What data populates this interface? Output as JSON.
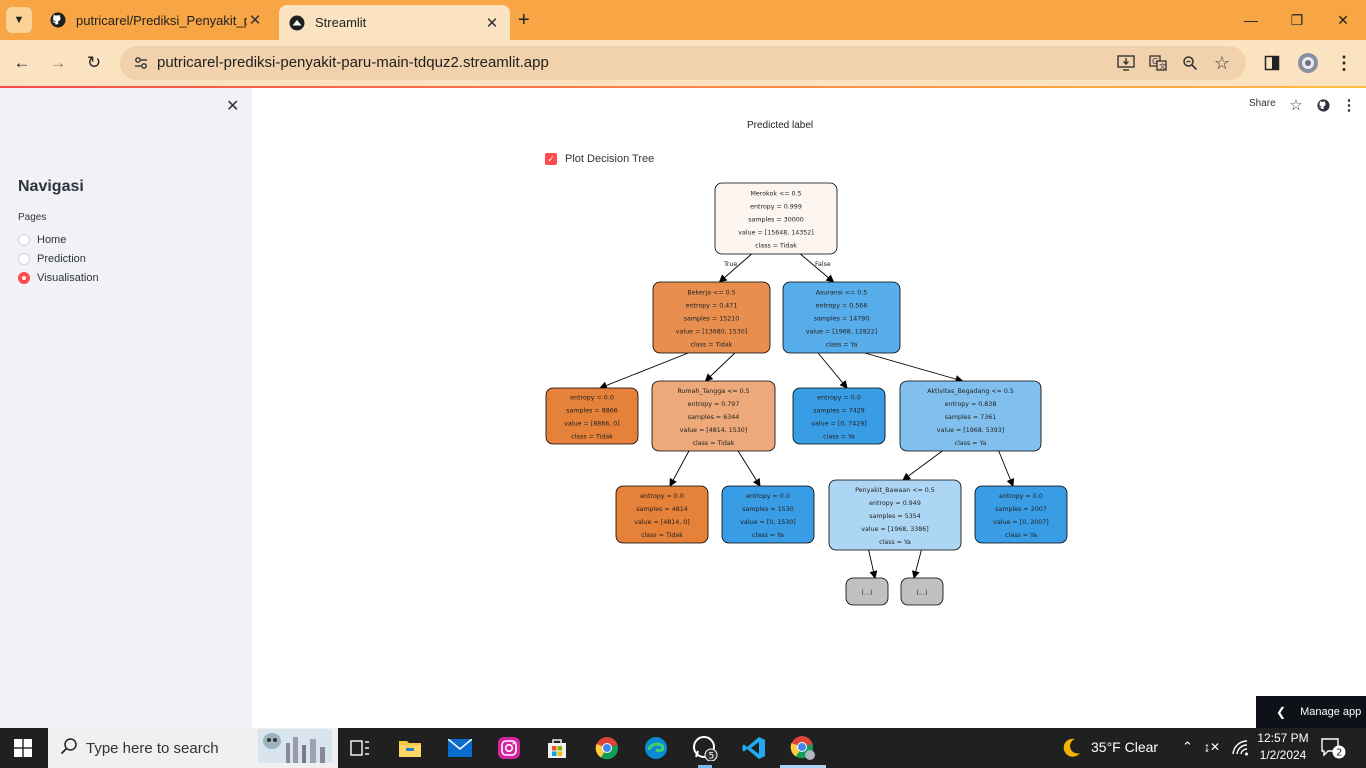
{
  "browser": {
    "tabs": [
      {
        "title": "putricarel/Prediksi_Penyakit_pa",
        "icon": "github-icon"
      },
      {
        "title": "Streamlit",
        "icon": "streamlit-icon"
      }
    ],
    "url": "putricarel-prediksi-penyakit-paru-main-tdquz2.streamlit.app",
    "accent_color": "#f7a545"
  },
  "sidebar": {
    "title": "Navigasi",
    "pages_label": "Pages",
    "items": [
      {
        "label": "Home",
        "selected": false
      },
      {
        "label": "Prediction",
        "selected": false
      },
      {
        "label": "Visualisation",
        "selected": true
      }
    ]
  },
  "header": {
    "share_label": "Share"
  },
  "main": {
    "predicted_label": "Predicted label",
    "checkbox_label": "Plot Decision Tree",
    "checkbox_checked": true
  },
  "tree": {
    "edge_true": "True",
    "edge_false": "False",
    "nodes": [
      {
        "id": "n0",
        "lines": [
          "Merokok <= 0.5",
          "entropy = 0.999",
          "samples = 30000",
          "value = [15648, 14352]",
          "class = Tidak"
        ],
        "fill": "#fdf5ef"
      },
      {
        "id": "n1",
        "lines": [
          "Bekerja <= 0.5",
          "entropy = 0.471",
          "samples = 15210",
          "value = [13680, 1530]",
          "class = Tidak"
        ],
        "fill": "#e88f4f"
      },
      {
        "id": "n2",
        "lines": [
          "Asuransi <= 0.5",
          "entropy = 0.566",
          "samples = 14790",
          "value = [1968, 12822]",
          "class = Ya"
        ],
        "fill": "#57acea"
      },
      {
        "id": "n3",
        "lines": [
          "entropy = 0.0",
          "samples = 8866",
          "value = [8866, 0]",
          "class = Tidak"
        ],
        "fill": "#e58139"
      },
      {
        "id": "n4",
        "lines": [
          "Rumah_Tangga <= 0.5",
          "entropy = 0.797",
          "samples = 6344",
          "value = [4814, 1530]",
          "class = Tidak"
        ],
        "fill": "#eda979"
      },
      {
        "id": "n5",
        "lines": [
          "entropy = 0.0",
          "samples = 7429",
          "value = [0, 7429]",
          "class = Ya"
        ],
        "fill": "#399de5"
      },
      {
        "id": "n6",
        "lines": [
          "Aktivitas_Begadang <= 0.5",
          "entropy = 0.838",
          "samples = 7361",
          "value = [1968, 5393]",
          "class = Ya"
        ],
        "fill": "#81c0ee"
      },
      {
        "id": "n7",
        "lines": [
          "entropy = 0.0",
          "samples = 4814",
          "value = [4814, 0]",
          "class = Tidak"
        ],
        "fill": "#e58139"
      },
      {
        "id": "n8",
        "lines": [
          "entropy = 0.0",
          "samples = 1530",
          "value = [0, 1530]",
          "class = Ya"
        ],
        "fill": "#399de5"
      },
      {
        "id": "n9",
        "lines": [
          "Penyakit_Bawaan <= 0.5",
          "entropy = 0.949",
          "samples = 5354",
          "value = [1968, 3386]",
          "class = Ya"
        ],
        "fill": "#acd6f4"
      },
      {
        "id": "n10",
        "lines": [
          "entropy = 0.0",
          "samples = 2007",
          "value = [0, 2007]",
          "class = Ya"
        ],
        "fill": "#399de5"
      },
      {
        "id": "n11",
        "lines": [
          "(...)"
        ],
        "fill": "#c0c0c0"
      },
      {
        "id": "n12",
        "lines": [
          "(...)"
        ],
        "fill": "#c0c0c0"
      }
    ],
    "edges": [
      [
        "n0",
        "n1"
      ],
      [
        "n0",
        "n2"
      ],
      [
        "n1",
        "n3"
      ],
      [
        "n1",
        "n4"
      ],
      [
        "n2",
        "n5"
      ],
      [
        "n2",
        "n6"
      ],
      [
        "n4",
        "n7"
      ],
      [
        "n4",
        "n8"
      ],
      [
        "n6",
        "n9"
      ],
      [
        "n6",
        "n10"
      ],
      [
        "n9",
        "n11"
      ],
      [
        "n9",
        "n12"
      ]
    ]
  },
  "manage_app_label": "Manage app",
  "taskbar": {
    "search_placeholder": "Type here to search",
    "whatsapp_badge": "5",
    "weather": "35°F  Clear",
    "time": "12:57 PM",
    "date": "1/2/2024",
    "notifications": "2"
  }
}
